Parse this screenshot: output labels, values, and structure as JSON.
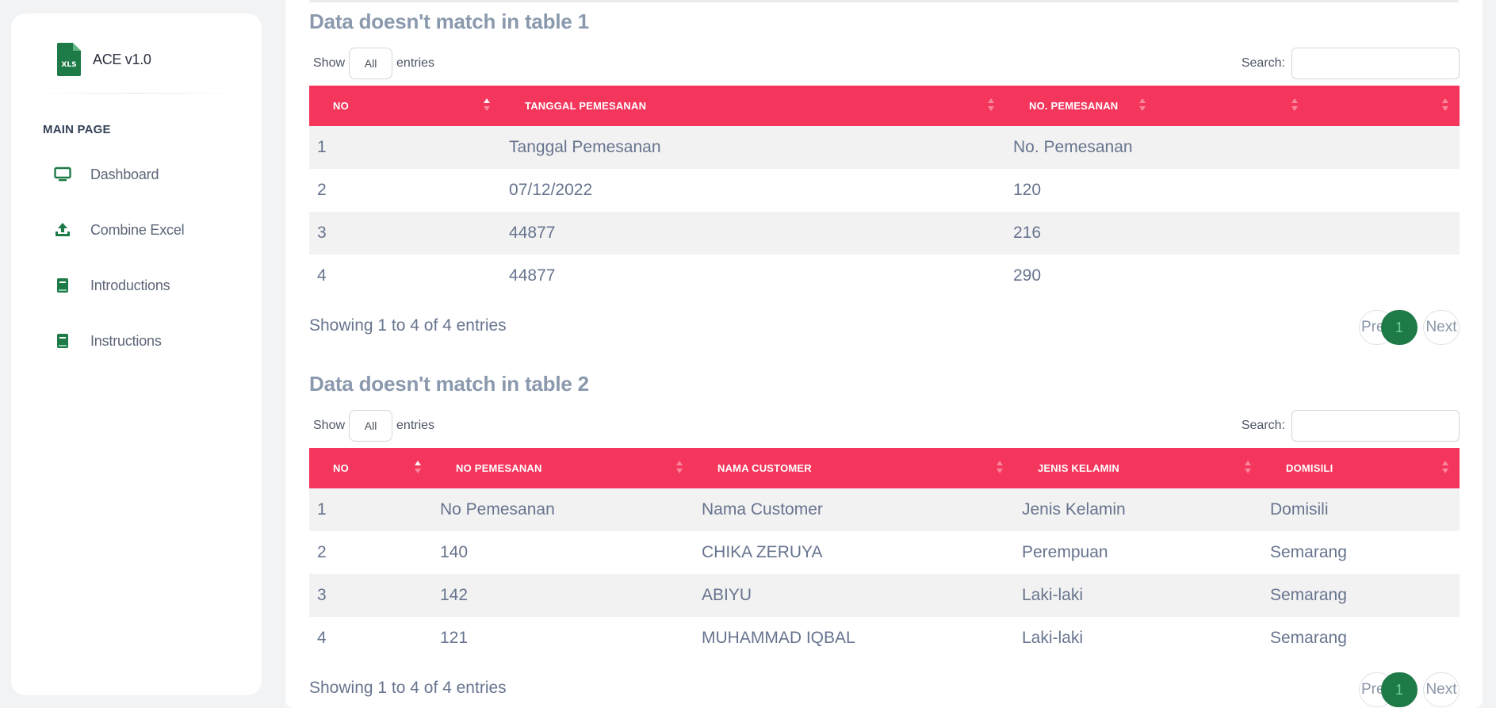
{
  "app": {
    "title": "ACE v1.0"
  },
  "sidebar": {
    "section": "MAIN PAGE",
    "items": [
      {
        "label": "Dashboard",
        "icon": "monitor-icon"
      },
      {
        "label": "Combine Excel",
        "icon": "upload-icon"
      },
      {
        "label": "Introductions",
        "icon": "book-icon"
      },
      {
        "label": "Instructions",
        "icon": "book-icon"
      }
    ]
  },
  "colors": {
    "accent": "#f5365c",
    "brand": "#1e7a47"
  },
  "table1": {
    "title": "Data doesn't match in table 1",
    "show_label": "Show",
    "length_value": "All",
    "entries_label": "entries",
    "search_label": "Search:",
    "headers": [
      "NO",
      "TANGGAL PEMESANAN",
      "NO. PEMESANAN",
      "",
      ""
    ],
    "rows": [
      [
        "1",
        "Tanggal Pemesanan",
        "No. Pemesanan",
        "",
        ""
      ],
      [
        "2",
        "07/12/2022",
        "120",
        "",
        ""
      ],
      [
        "3",
        "44877",
        "216",
        "",
        ""
      ],
      [
        "4",
        "44877",
        "290",
        "",
        ""
      ]
    ],
    "info": "Showing 1 to 4 of 4 entries",
    "pagination": {
      "previous": "Previous",
      "current": "1",
      "next": "Next"
    }
  },
  "table2": {
    "title": "Data doesn't match in table 2",
    "show_label": "Show",
    "length_value": "All",
    "entries_label": "entries",
    "search_label": "Search:",
    "headers": [
      "NO",
      "NO PEMESANAN",
      "NAMA CUSTOMER",
      "JENIS KELAMIN",
      "DOMISILI"
    ],
    "rows": [
      [
        "1",
        "No Pemesanan",
        "Nama Customer",
        "Jenis Kelamin",
        "Domisili"
      ],
      [
        "2",
        "140",
        "CHIKA ZERUYA",
        "Perempuan",
        "Semarang"
      ],
      [
        "3",
        "142",
        "ABIYU",
        "Laki-laki",
        "Semarang"
      ],
      [
        "4",
        "121",
        "MUHAMMAD IQBAL",
        "Laki-laki",
        "Semarang"
      ]
    ],
    "info": "Showing 1 to 4 of 4 entries",
    "pagination": {
      "previous": "Previous",
      "current": "1",
      "next": "Next"
    }
  }
}
